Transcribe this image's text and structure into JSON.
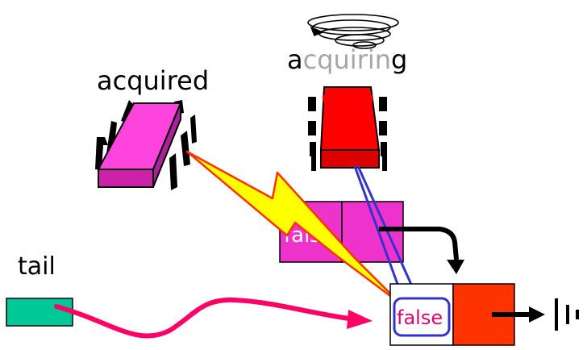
{
  "labels": {
    "acquired": "acquired",
    "acquiring_dark_start": "a",
    "acquiring_gray_mid": "cquirin",
    "acquiring_dark_end": "g",
    "tail": "tail"
  },
  "nodes": {
    "left_node_flag": "false",
    "right_node_flag": "false"
  },
  "colors": {
    "acquired_thread": "#ff33cc",
    "acquiring_thread": "#ff0000",
    "left_node": "#ee33cc",
    "right_node_flag_text": "#e0006e",
    "right_node_flag_border": "#3333cc",
    "right_node_tail_cell": "#ff3300",
    "tail_box": "#00c897",
    "tail_arrow": "#ff0066",
    "lightning_fill": "#ffff00",
    "lightning_stroke": "#ff3300",
    "spin_lines": "#3333cc"
  },
  "icons": {
    "acquired_thread": "chip-icon",
    "acquiring_thread": "chip-icon",
    "spin": "spin-scribble-icon",
    "lightning": "lightning-bolt-icon",
    "ground": "ground-icon"
  }
}
